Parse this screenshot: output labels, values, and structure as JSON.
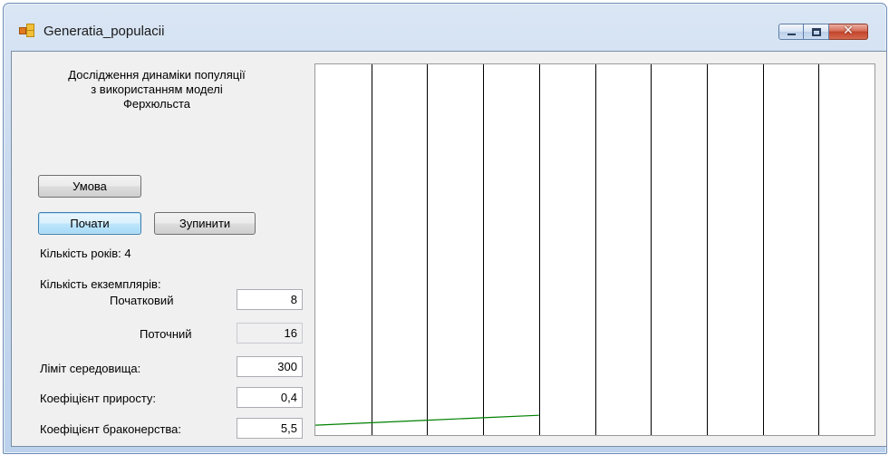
{
  "window": {
    "title": "Generatia_populacii",
    "controls": {
      "minimize": "—",
      "maximize": "□",
      "close": "✕"
    }
  },
  "panel": {
    "heading": "Дослідження динаміки популяції\nз використанням моделі\nФерхюльста",
    "buttons": {
      "condition": "Умова",
      "start": "Почати",
      "stop": "Зупинити"
    },
    "years_label": "Кількість років: 4",
    "specimens_label": "Кількість екземплярів:",
    "initial_label": "Початковий",
    "initial_value": "8",
    "current_label": "Поточний",
    "current_value": "16",
    "env_limit_label": "Ліміт середовища:",
    "env_limit_value": "300",
    "growth_label": "Коефіцієнт приросту:",
    "growth_value": "0,4",
    "poaching_label": "Коефіцієнт браконерства:",
    "poaching_value": "5,5"
  },
  "chart_data": {
    "type": "line",
    "x": [
      0,
      1,
      2,
      3,
      4
    ],
    "series": [
      {
        "values": [
          8,
          10,
          12,
          14,
          16
        ],
        "color": "#008000"
      }
    ],
    "xlim": [
      0,
      10
    ],
    "ylim": [
      0,
      300
    ],
    "grid": "vertical",
    "grid_color": "#000000"
  }
}
